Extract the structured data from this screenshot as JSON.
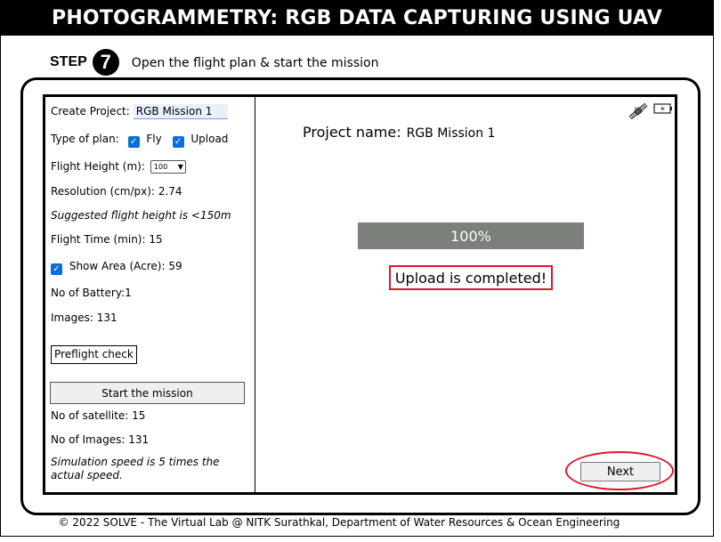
{
  "header": {
    "title": "PHOTOGRAMMETRY: RGB DATA CAPTURING USING UAV"
  },
  "step": {
    "label": "STEP",
    "number": "7",
    "instruction": "Open the flight plan & start the mission"
  },
  "left_panel": {
    "create_project_label": "Create Project:",
    "project_value": "RGB Mission 1",
    "type_of_plan_label": "Type of plan:",
    "fly_label": "Fly",
    "upload_label": "Upload",
    "fly_checked": true,
    "upload_checked": true,
    "flight_height_label": "Flight Height (m):",
    "flight_height_value": "100",
    "resolution_label": "Resolution (cm/px):",
    "resolution_value": "2.74",
    "suggestion": "Suggested flight height is <150m",
    "flight_time_label": "Flight Time (min):",
    "flight_time_value": "15",
    "show_area_label": "Show Area (Acre):",
    "show_area_value": "59",
    "show_area_checked": true,
    "battery_label": "No of Battery:",
    "battery_value": "1",
    "images_label": "Images:",
    "images_value": "131",
    "preflight_button": "Preflight check",
    "start_button": "Start the mission",
    "satellite_label": "No of satellite:",
    "satellite_value": "15",
    "no_images_label": "No of Images:",
    "no_images_value": "131",
    "sim_note": "Simulation speed is 5 times the actual speed."
  },
  "right_panel": {
    "project_name_label": "Project name:",
    "project_name_value": "RGB Mission 1",
    "progress_text": "100%",
    "progress_fraction": 1.0,
    "status_text": "Upload is completed!",
    "next_button": "Next",
    "icons": [
      "satellite-icon",
      "battery-icon"
    ]
  },
  "colors": {
    "highlight": "#e0152a",
    "progress": "#7b807b",
    "checkbox": "#0b6fd6"
  },
  "footer": {
    "text": "© 2022 SOLVE - The Virtual Lab @ NITK Surathkal, Department of Water Resources & Ocean Engineering"
  }
}
